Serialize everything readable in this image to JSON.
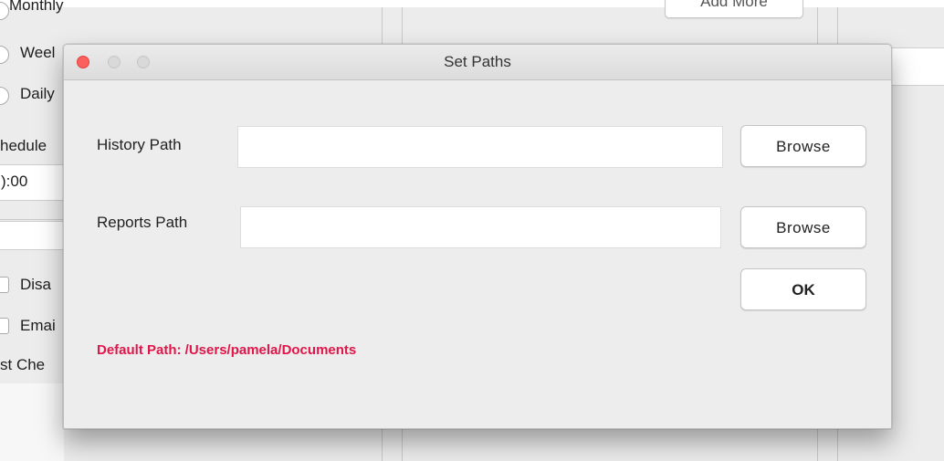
{
  "background": {
    "top_button_label": "Add More",
    "left_column": {
      "radio_monthly": "Monthly",
      "radio_weekly": "Weel",
      "radio_daily": "Daily",
      "schedule_label": "hedule",
      "time_value": "):00",
      "checkbox_disable": "Disa",
      "checkbox_email": "Emai",
      "last_check_label": "st Che"
    }
  },
  "dialog": {
    "title": "Set Paths",
    "history": {
      "label": "History Path",
      "value": "",
      "browse_label": "Browse"
    },
    "reports": {
      "label": "Reports Path",
      "value": "",
      "browse_label": "Browse"
    },
    "ok_label": "OK",
    "default_path_note": "Default Path: /Users/pamela/Documents",
    "colors": {
      "note": "#e0154a",
      "close_button": "#fc605c"
    }
  }
}
